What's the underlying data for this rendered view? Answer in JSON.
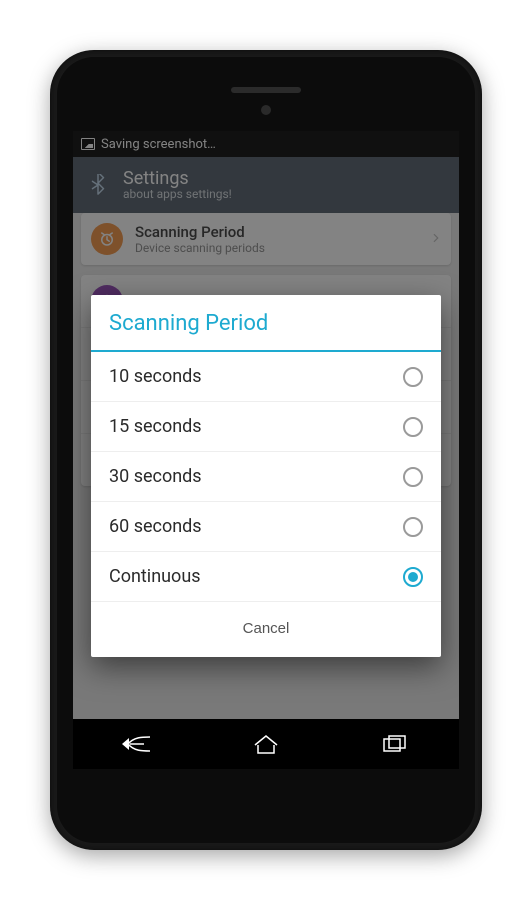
{
  "status_bar": {
    "text": "Saving screenshot…"
  },
  "action_bar": {
    "title": "Settings",
    "subtitle": "about apps settings!"
  },
  "background_list": {
    "items": [
      {
        "title": "Scanning Period",
        "subtitle": "Device scanning periods",
        "badge_color": "#f3903d"
      },
      {
        "title": "",
        "subtitle": "",
        "badge_color": "#8e3fb3"
      },
      {
        "title": "",
        "subtitle": "",
        "badge_color": "#333333"
      },
      {
        "title": "",
        "subtitle": "",
        "badge_color": "#2fb66a"
      },
      {
        "title": "",
        "subtitle": "",
        "badge_color": "#d94a4a"
      }
    ]
  },
  "dialog": {
    "title": "Scanning Period",
    "options": [
      {
        "label": "10 seconds",
        "selected": false
      },
      {
        "label": "15 seconds",
        "selected": false
      },
      {
        "label": "30 seconds",
        "selected": false
      },
      {
        "label": "60 seconds",
        "selected": false
      },
      {
        "label": "Continuous",
        "selected": true
      }
    ],
    "cancel_label": "Cancel"
  },
  "colors": {
    "accent": "#1eaad0"
  }
}
